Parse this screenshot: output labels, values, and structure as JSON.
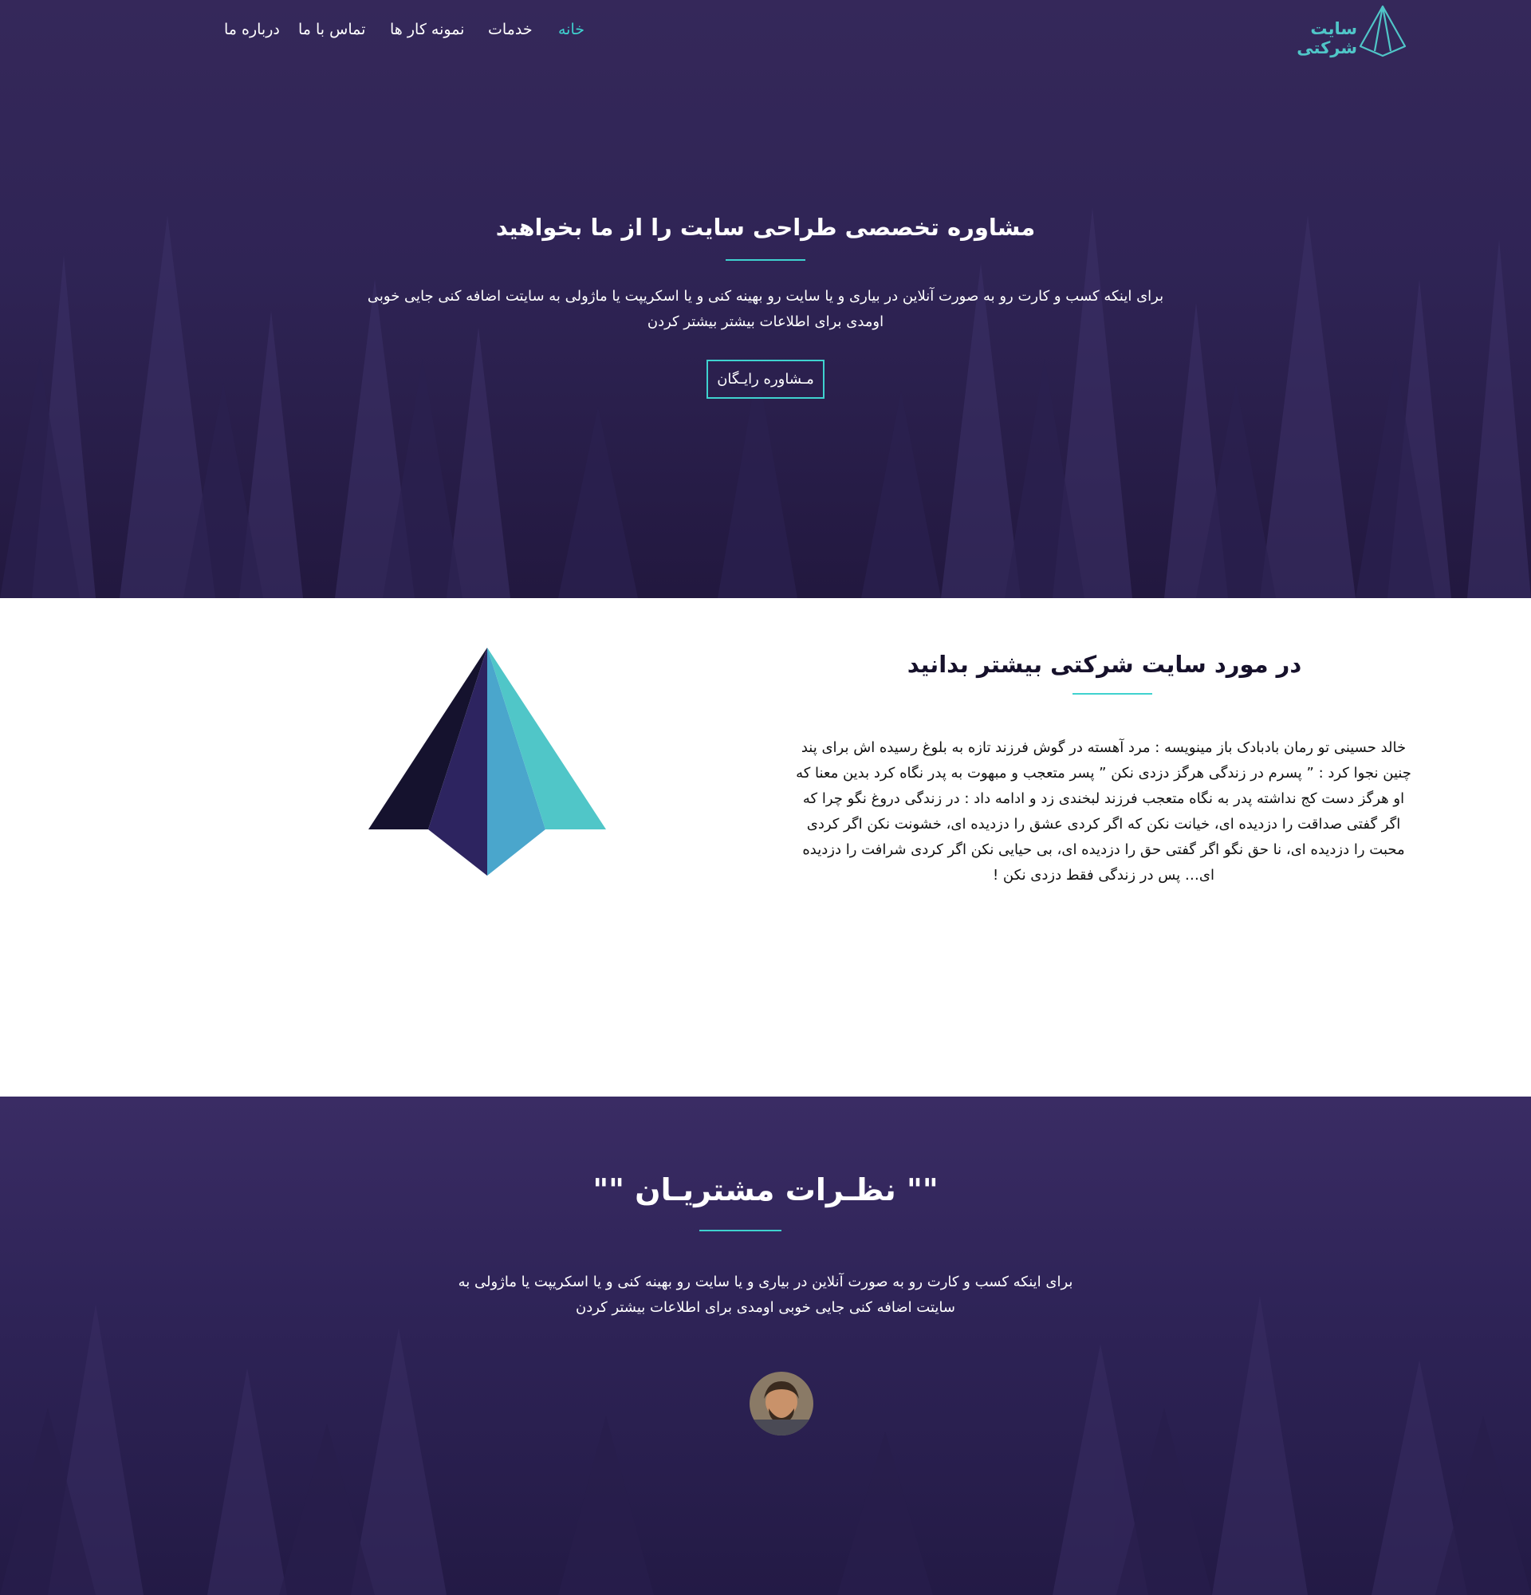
{
  "brand": {
    "name": "سایت شرکتی",
    "logo_color": "#50c6c8"
  },
  "nav": {
    "items": [
      {
        "label": "خانه",
        "active": true
      },
      {
        "label": "خدمات",
        "active": false
      },
      {
        "label": "نمونه کار ها",
        "active": false
      },
      {
        "label": "تماس با ما",
        "active": false
      },
      {
        "label": "درباره ما",
        "active": false
      }
    ]
  },
  "hero": {
    "title": "مشاوره تخصصی طراحی سایت را از ما بخواهید",
    "description": "برای اینکه کسب و کارت رو به صورت آنلاین در بیاری و یا سایت رو بهینه کنی و یا اسکریپت یا ماژولی به سایتت اضافه کنی جایی خوبی اومدی برای اطلاعات بیشتر بیشتر کردن",
    "button_label": "مـشاوره رایـگان"
  },
  "about": {
    "title": "در مورد سایت شرکتی بیشتر بدانید",
    "text": "خالد حسینی تو رمان بادبادک باز مینویسه : مرد آهسته در گوش فرزند تازه به بلوغ رسیده اش برای پند چنین نجوا کرد : ” پسرم در زندگی هرگز دزدی نکن ” پسر متعجب و مبهوت به پدر نگاه کرد بدین معنا که او هرگز دست کج نداشته پدر به نگاه متعجب فرزند لبخندی زد و ادامه داد : در زندگی دروغ نگو چرا که اگر گفتی صداقت را دزدیده ای، خیانت نکن که اگر کردی عشق را دزدیده ای، خشونت نکن اگر کردی محبت را دزدیده ای، نا حق نگو اگر گفتی حق را دزدیده ای، بی حیایی نکن اگر کردی شرافت را دزدیده ای… پس در زندگی فقط دزدی نکن !"
  },
  "testimonials": {
    "title": "\"\" نظـرات مشتریـان \"\"",
    "description": "برای اینکه کسب و کارت رو به صورت آنلاین در بیاری و یا سایت رو بهینه کنی و یا اسکریپت یا ماژولی به سایتت اضافه کنی جایی خوبی اومدی برای اطلاعات بیشتر کردن"
  },
  "colors": {
    "accent": "#3fd2cf",
    "hero_bg": "#2f2455",
    "pyramid": [
      "#15122e",
      "#2d2460",
      "#4aa6cc",
      "#50c6c8"
    ]
  }
}
